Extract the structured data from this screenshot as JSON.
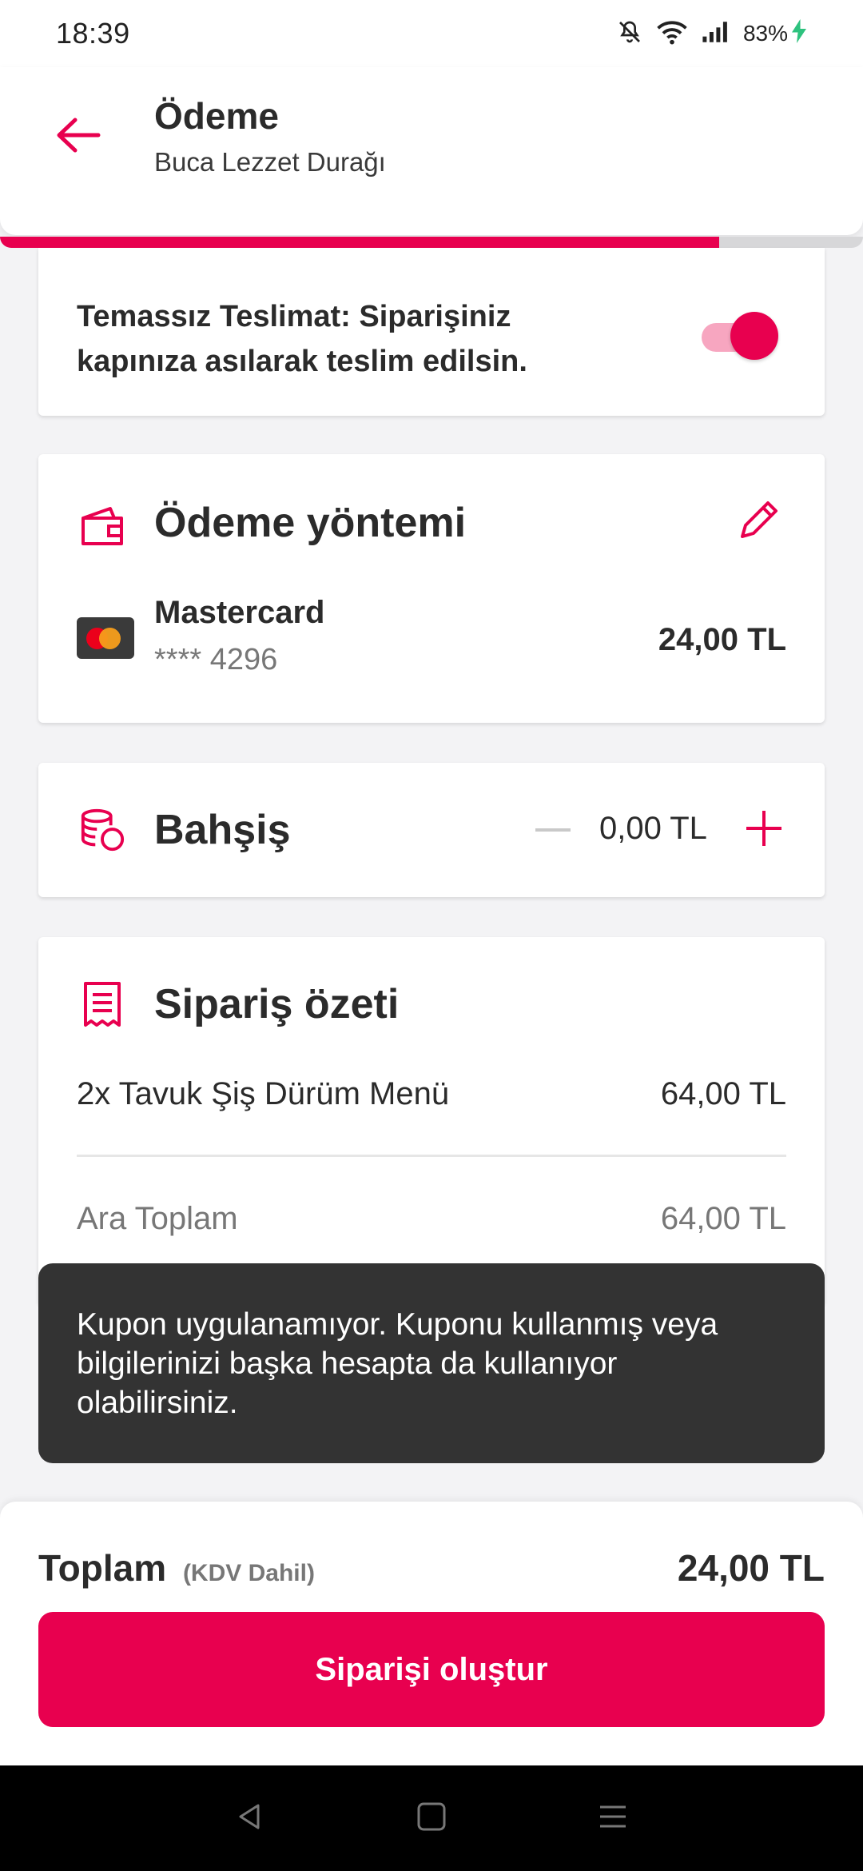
{
  "status_bar": {
    "time": "18:39",
    "battery": "83%"
  },
  "header": {
    "title": "Ödeme",
    "subtitle": "Buca Lezzet Durağı",
    "progress_fraction": 0.833
  },
  "contactless": {
    "label": "Temassız Teslimat: Siparişiniz kapınıza asılarak teslim edilsin.",
    "enabled": true
  },
  "payment": {
    "heading": "Ödeme yöntemi",
    "card_name": "Mastercard",
    "card_number": "**** 4296",
    "amount": "24,00 TL"
  },
  "tip": {
    "heading": "Bahşiş",
    "value": "0,00 TL"
  },
  "summary": {
    "heading": "Sipariş özeti",
    "items": [
      {
        "name": "2x Tavuk Şiş Dürüm Menü",
        "price": "64,00 TL"
      }
    ],
    "subtotal_label": "Ara Toplam",
    "subtotal_value": "64,00 TL"
  },
  "toast": {
    "message": "Kupon uygulanamıyor. Kuponu kullanmış veya bilgilerinizi başka hesapta da kullanıyor olabilirsiniz."
  },
  "footer": {
    "total_label": "Toplam",
    "total_note": "(KDV Dahil)",
    "total_amount": "24,00 TL",
    "submit_label": "Siparişi oluştur"
  },
  "colors": {
    "accent": "#e8004f",
    "toast_bg": "#333333"
  }
}
